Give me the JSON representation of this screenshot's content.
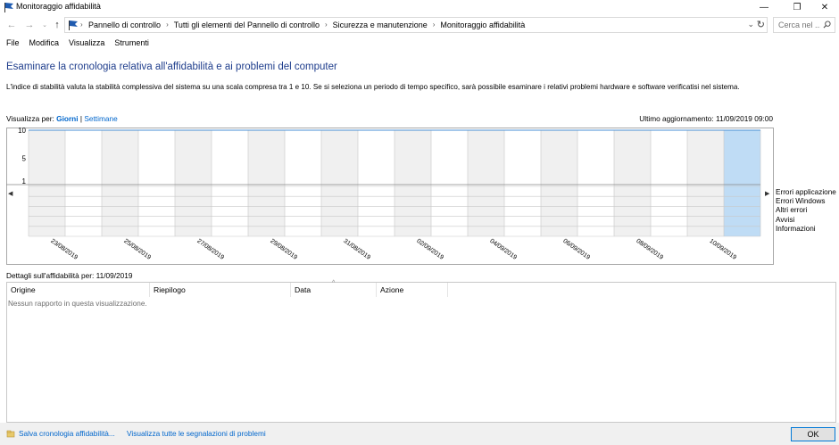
{
  "window": {
    "title": "Monitoraggio affidabilità",
    "minimize": "—",
    "restore": "❐",
    "close": "✕"
  },
  "address": {
    "breadcrumbs": [
      "Pannello di controllo",
      "Tutti gli elementi del Pannello di controllo",
      "Sicurezza e manutenzione",
      "Monitoraggio affidabilità"
    ],
    "separator": "›",
    "search_placeholder": "Cerca nel ..."
  },
  "menu": [
    "File",
    "Modifica",
    "Visualizza",
    "Strumenti"
  ],
  "main": {
    "title": "Esaminare la cronologia relativa all'affidabilità e ai problemi del computer",
    "description": "L'indice di stabilità valuta la stabilità complessiva del sistema su una scala compresa tra 1 e 10. Se si seleziona un periodo di tempo specifico, sarà possibile esaminare i relativi problemi hardware e software verificatisi nel sistema.",
    "view_by_label": "Visualizza per:",
    "view_days": "Giorni",
    "view_separator": "|",
    "view_weeks": "Settimane",
    "last_update": "Ultimo aggiornamento: 11/09/2019 09:00"
  },
  "chart_data": {
    "type": "line",
    "y_ticks": [
      "10",
      "5",
      "1"
    ],
    "ylim": [
      1,
      10
    ],
    "x_labels": [
      "23/08/2019",
      "25/08/2019",
      "27/08/2019",
      "29/08/2019",
      "31/08/2019",
      "02/09/2019",
      "04/09/2019",
      "06/09/2019",
      "08/09/2019",
      "10/09/2019"
    ],
    "days": 20,
    "selected_day": "11/09/2019",
    "stability_index": 10,
    "legend": [
      "Errori applicazione",
      "Errori Windows",
      "Altri errori",
      "Avvisi",
      "Informazioni"
    ],
    "colors": {
      "stripe": "#f0f0f0",
      "selected": "#bfdcf5",
      "line": "#4a8fd4",
      "grid": "#c8c8c8"
    }
  },
  "details": {
    "label": "Dettagli sull'affidabilità per: 11/09/2019",
    "columns": [
      "Origine",
      "Riepilogo",
      "Data",
      "Azione"
    ],
    "sort_indicator": "^",
    "empty_message": "Nessun rapporto in questa visualizzazione."
  },
  "footer": {
    "save_link": "Salva cronologia affidabilità...",
    "view_reports_link": "Visualizza tutte le segnalazioni di problemi",
    "ok_button": "OK"
  }
}
